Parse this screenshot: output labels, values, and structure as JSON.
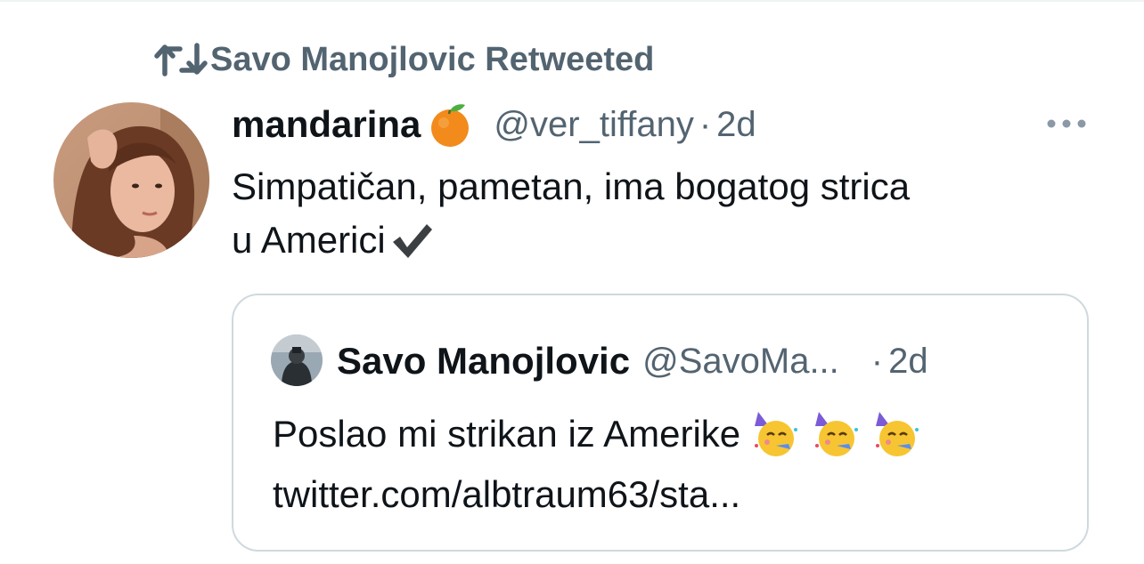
{
  "retweet": {
    "icon": "retweet-icon",
    "text": "Savo Manojlovic Retweeted"
  },
  "tweet": {
    "author_name": "mandarina",
    "name_emoji": "tangerine-emoji",
    "handle": "@ver_tiffany",
    "separator": "·",
    "time": "2d",
    "more_icon": "more-horizontal-icon",
    "text_line1": "Simpatičan, pametan, ima bogatog strica",
    "text_line2": "u Americi",
    "text_emoji": "check-mark-emoji"
  },
  "quote": {
    "author_name": "Savo Manojlovic",
    "handle": "@SavoMa...",
    "separator": "·",
    "time": "2d",
    "text_line1": "Poslao mi strikan iz Amerike",
    "text_emojis": [
      "partying-face-emoji",
      "partying-face-emoji",
      "partying-face-emoji"
    ],
    "link": "twitter.com/albtraum63/sta..."
  },
  "colors": {
    "text_primary": "#0f1419",
    "text_secondary": "#536471",
    "border": "#cfd9de"
  }
}
